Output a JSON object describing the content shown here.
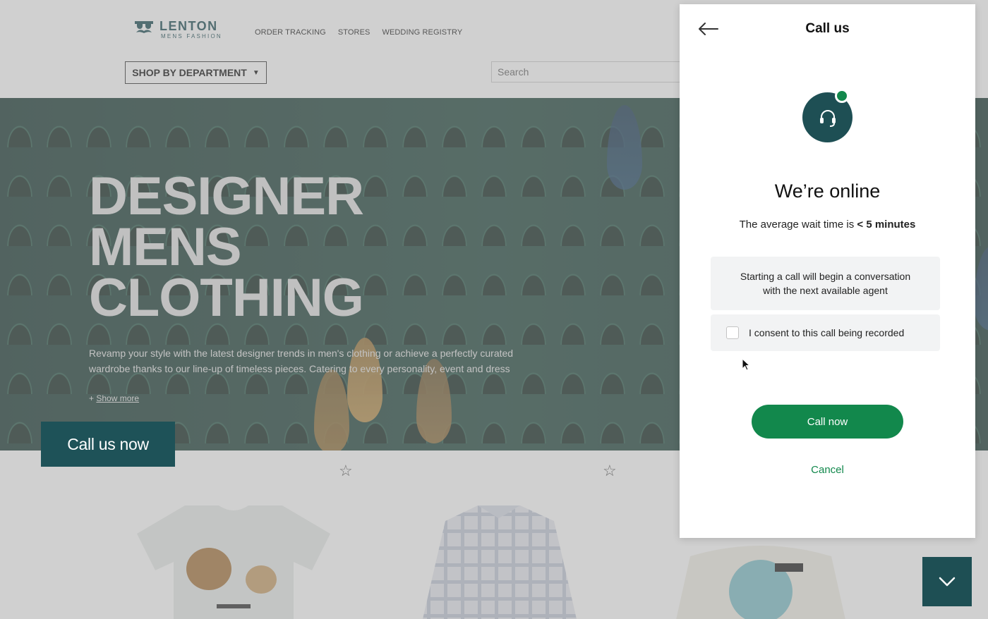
{
  "header": {
    "logo_name": "LENTON",
    "logo_sub": "MENS FASHION",
    "nav": [
      "ORDER TRACKING",
      "STORES",
      "WEDDING REGISTRY"
    ],
    "department_button": "SHOP BY DEPARTMENT",
    "search_placeholder": "Search"
  },
  "hero": {
    "title_lines": [
      "DESIGNER",
      "MENS",
      "CLOTHING"
    ],
    "description": "Revamp your style with the latest designer trends in men's clothing or achieve a perfectly curated wardrobe thanks to our line-up of timeless pieces. Catering to every personality, event and dress",
    "show_more_prefix": "+",
    "show_more": "Show more",
    "call_us_now": "Call us now"
  },
  "call_panel": {
    "title": "Call us",
    "status_title": "We’re online",
    "wait_prefix": "The average wait time is",
    "wait_value": "< 5 minutes",
    "info_text": "Starting a call will begin a conversation with the next available agent",
    "consent_label": "I consent to this call being recorded",
    "consent_checked": false,
    "call_button": "Call now",
    "cancel": "Cancel",
    "online_color": "#12884c",
    "brand_color": "#1e4f54"
  }
}
